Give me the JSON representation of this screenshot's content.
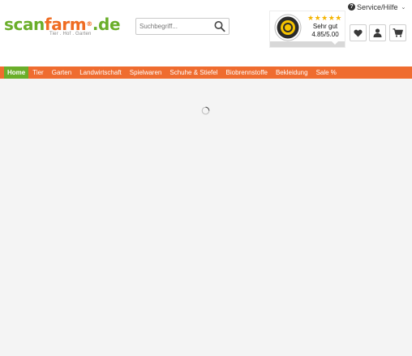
{
  "logo": {
    "part1": "scan",
    "part2": "farm",
    "part3": ".de",
    "registered": "®",
    "tagline": "Tier . Hof . Garten"
  },
  "search": {
    "placeholder": "Suchbegriff..."
  },
  "trust": {
    "stars": "★★★★★",
    "rating_text": "Sehr gut",
    "score": "4.85/5.00"
  },
  "service": {
    "label": "Service/Hilfe"
  },
  "nav": {
    "items": [
      "Home",
      "Tier",
      "Garten",
      "Landwirtschaft",
      "Spielwaren",
      "Schuhe & Stiefel",
      "Biobrennstoffe",
      "Bekleidung",
      "Sale %"
    ]
  },
  "colors": {
    "brand_green": "#6aae2a",
    "brand_orange": "#ef6c22",
    "nav_bar": "#ef6c2f",
    "star": "#f4b400"
  },
  "icons": {
    "search": "search-icon",
    "wishlist": "heart-icon",
    "account": "user-icon",
    "cart": "cart-icon",
    "service": "question-circle-icon",
    "loading": "spinner-icon"
  }
}
